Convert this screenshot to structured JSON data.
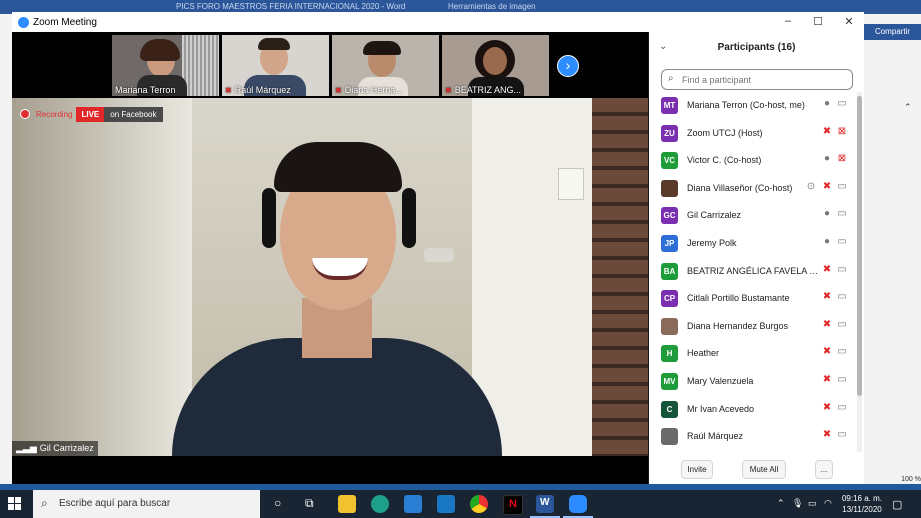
{
  "background_app": {
    "doc_title": "PICS FORO MAESTROS FERIA INTERNACIONAL 2020 - Word",
    "context_tab": "Herramientas de imagen",
    "share_label": "Compartir",
    "zoom_level": "100 %"
  },
  "window": {
    "title": "Zoom Meeting",
    "minimize": "–",
    "maximize": "☐",
    "close": "✕"
  },
  "thumbnails": [
    {
      "name": "Mariana Terron",
      "muted": false
    },
    {
      "name": "Raúl Márquez",
      "muted": true
    },
    {
      "name": "Diana Herna...",
      "muted": true
    },
    {
      "name": "BEATRIZ ANG...",
      "muted": true
    }
  ],
  "main_video": {
    "recording_label": "Recording",
    "live_label": "LIVE",
    "platform_label": "on Facebook",
    "speaker_name": "Gil Carrizalez"
  },
  "participants_panel": {
    "title": "Participants (16)",
    "search_placeholder": "Find a participant",
    "invite_label": "Invite",
    "mute_all_label": "Mute All",
    "more_label": "...",
    "participants": [
      {
        "initials": "MT",
        "name": "Mariana Terron (Co-host, me)",
        "color": "#7a2fb0",
        "mic": "on",
        "cam": "on"
      },
      {
        "initials": "ZU",
        "name": "Zoom UTCJ (Host)",
        "color": "#7a2fb0",
        "mic": "muted",
        "cam": "off"
      },
      {
        "initials": "VC",
        "name": "Victor C. (Co-host)",
        "color": "#1e9c3a",
        "mic": "on",
        "cam": "off"
      },
      {
        "initials": "",
        "name": "Diana Villaseñor (Co-host)",
        "color": "#5a3a2a",
        "mic": "muted",
        "cam": "on",
        "photo": true,
        "share": true
      },
      {
        "initials": "GC",
        "name": "Gil Carrizalez",
        "color": "#7a2fb0",
        "mic": "on",
        "cam": "on"
      },
      {
        "initials": "JP",
        "name": "Jeremy Polk",
        "color": "#2d6fd6",
        "mic": "on",
        "cam": "on"
      },
      {
        "initials": "BA",
        "name": "BEATRIZ ANGÉLICA FAVELA SAN...",
        "color": "#1e9c3a",
        "mic": "muted",
        "cam": "on"
      },
      {
        "initials": "CP",
        "name": "Citlali Portillo Bustamante",
        "color": "#7a2fb0",
        "mic": "muted",
        "cam": "on"
      },
      {
        "initials": "",
        "name": "Diana Hernandez Burgos",
        "color": "#8a6a5a",
        "mic": "muted",
        "cam": "on",
        "photo": true
      },
      {
        "initials": "H",
        "name": "Heather",
        "color": "#1e9c3a",
        "mic": "muted",
        "cam": "on"
      },
      {
        "initials": "MV",
        "name": "Mary Valenzuela",
        "color": "#1e9c3a",
        "mic": "muted",
        "cam": "on"
      },
      {
        "initials": "C",
        "name": "Mr Ivan Acevedo",
        "color": "#14553a",
        "mic": "muted",
        "cam": "on"
      },
      {
        "initials": "",
        "name": "Raúl Márquez",
        "color": "#6a6a6a",
        "mic": "muted",
        "cam": "on",
        "photo": true
      }
    ]
  },
  "taskbar": {
    "search_placeholder": "Escribe aquí para buscar",
    "time": "09:16 a. m.",
    "date": "13/11/2020",
    "pinned_icons": [
      "cortana-icon",
      "task-view-icon",
      "file-explorer-icon",
      "edge-icon",
      "mail-icon",
      "photos-icon",
      "chrome-icon",
      "netflix-icon",
      "word-icon",
      "zoom-icon"
    ]
  }
}
